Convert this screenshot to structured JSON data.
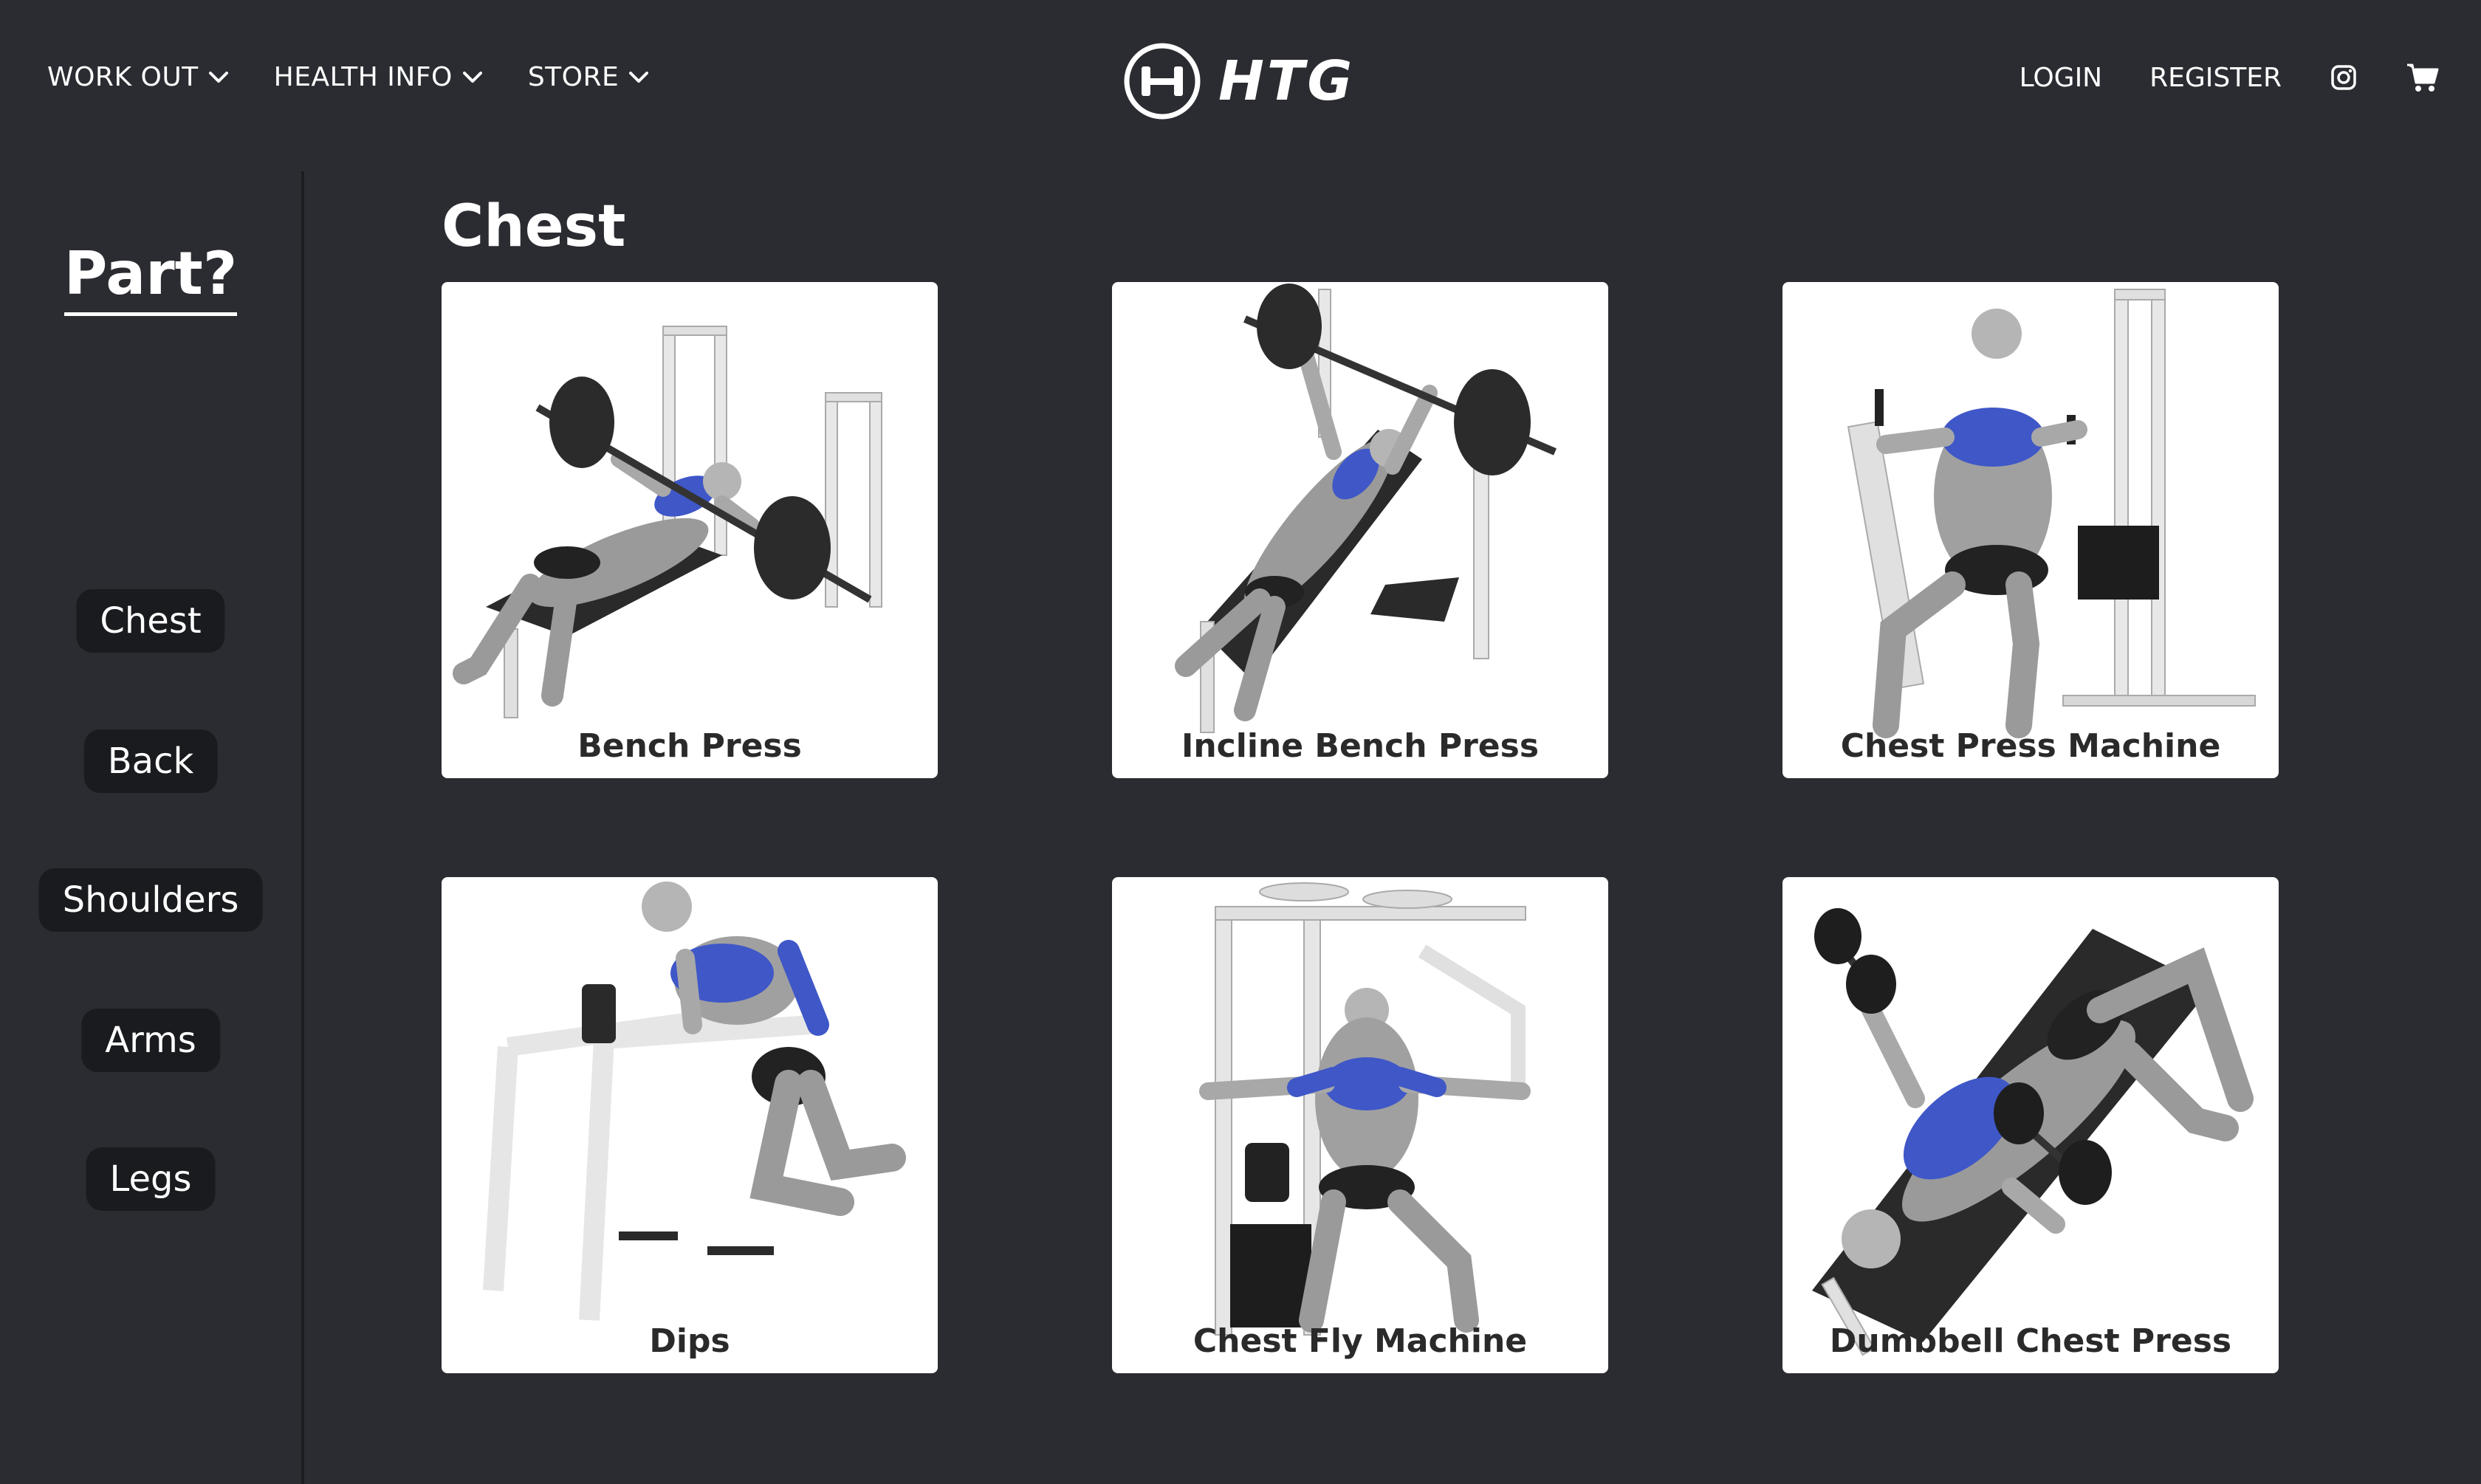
{
  "header": {
    "nav_left": [
      {
        "label": "WORK OUT"
      },
      {
        "label": "HEALTH INFO"
      },
      {
        "label": "STORE"
      }
    ],
    "logo_text": "HTG",
    "login_label": "LOGIN",
    "register_label": "REGISTER",
    "icons": {
      "instagram": "instagram-icon",
      "cart": "cart-icon"
    }
  },
  "sidebar": {
    "title": "Part?",
    "parts": [
      {
        "label": "Chest"
      },
      {
        "label": "Back"
      },
      {
        "label": "Shoulders"
      },
      {
        "label": "Arms"
      },
      {
        "label": "Legs"
      }
    ]
  },
  "main": {
    "title": "Chest",
    "exercises": [
      {
        "name": "Bench Press"
      },
      {
        "name": "Incline Bench Press"
      },
      {
        "name": "Chest Press Machine"
      },
      {
        "name": "Dips"
      },
      {
        "name": "Chest Fly Machine"
      },
      {
        "name": "Dumbbell Chest Press"
      }
    ]
  },
  "colors": {
    "background": "#2b2c31",
    "pill": "#1a1b1f",
    "muscle_highlight": "#3f57c7",
    "card": "#ffffff"
  }
}
